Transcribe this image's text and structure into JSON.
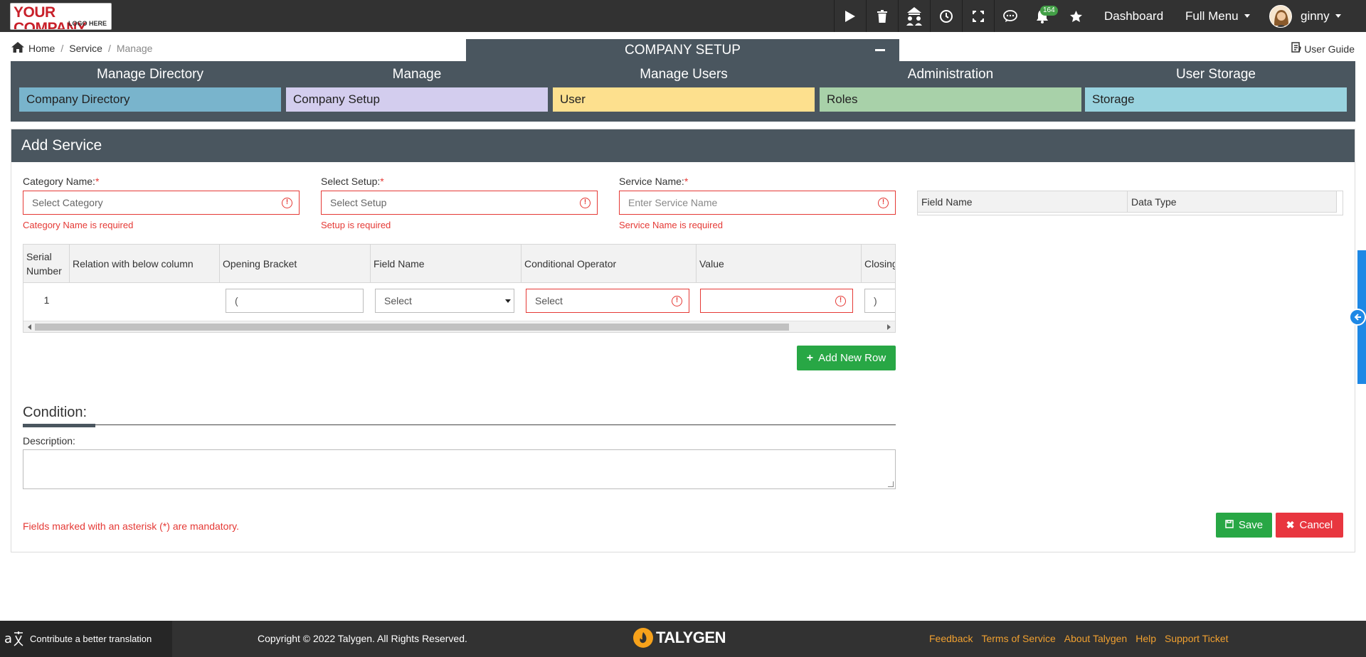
{
  "logo": {
    "line1": "YOUR COMPANY",
    "line2": "LOGO HERE"
  },
  "topnav": {
    "notification_count": "164",
    "dashboard": "Dashboard",
    "full_menu": "Full Menu",
    "username": "ginny"
  },
  "breadcrumb": {
    "home": "Home",
    "service": "Service",
    "current": "Manage",
    "sep": "/"
  },
  "user_guide": "User Guide",
  "company_setup": {
    "title": "COMPANY SETUP",
    "columns": [
      {
        "header": "Manage Directory",
        "item": "Company Directory",
        "color": "#79b4cc"
      },
      {
        "header": "Manage",
        "item": "Company Setup",
        "color": "#d3cdee"
      },
      {
        "header": "Manage Users",
        "item": "User",
        "color": "#fde08e"
      },
      {
        "header": "Administration",
        "item": "Roles",
        "color": "#a8d1a9"
      },
      {
        "header": "User Storage",
        "item": "Storage",
        "color": "#99d3df"
      }
    ]
  },
  "form": {
    "title": "Add Service",
    "category": {
      "label": "Category Name:",
      "placeholder": "Select Category",
      "error": "Category Name is required"
    },
    "setup": {
      "label": "Select Setup:",
      "placeholder": "Select Setup",
      "error": "Setup is required"
    },
    "service": {
      "label": "Service Name:",
      "placeholder": "Enter Service Name",
      "error": "Service Name is required"
    },
    "required_mark": "*",
    "grid": {
      "headers": [
        "Serial Number",
        "Relation with below column",
        "Opening Bracket",
        "Field Name",
        "Conditional Operator",
        "Value",
        "Closing"
      ],
      "row": {
        "serial": "1",
        "opening": "(",
        "field_name": "Select",
        "operator": "Select",
        "value": "",
        "closing": ")"
      }
    },
    "add_row": "Add New Row",
    "field_table": {
      "headers": [
        "Field Name",
        "Data Type"
      ]
    },
    "condition_title": "Condition:",
    "description_label": "Description:",
    "mandatory_note": "Fields marked with an asterisk (*) are mandatory.",
    "save": "Save",
    "cancel": "Cancel"
  },
  "footer": {
    "contribute": "Contribute a better translation",
    "copyright": "Copyright © 2022 Talygen. All Rights Reserved.",
    "brand": "TALYGEN",
    "links": [
      "Feedback",
      "Terms of Service",
      "About Talygen",
      "Help",
      "Support Ticket"
    ]
  }
}
